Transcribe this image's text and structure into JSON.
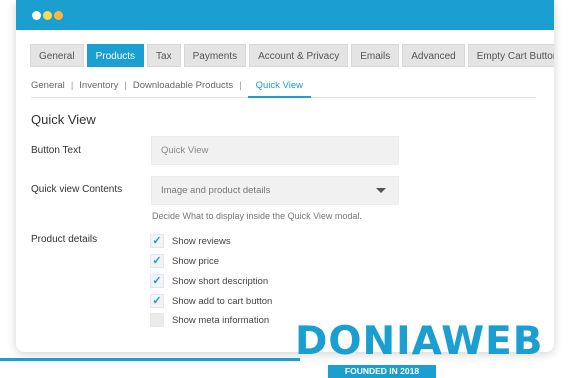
{
  "tabs": [
    {
      "label": "General",
      "active": false
    },
    {
      "label": "Products",
      "active": true
    },
    {
      "label": "Tax",
      "active": false
    },
    {
      "label": "Payments",
      "active": false
    },
    {
      "label": "Account & Privacy",
      "active": false
    },
    {
      "label": "Emails",
      "active": false
    },
    {
      "label": "Advanced",
      "active": false
    },
    {
      "label": "Empty Cart Button",
      "active": false
    }
  ],
  "subnav": {
    "items": [
      "General",
      "Inventory",
      "Downloadable Products",
      "Quick View"
    ],
    "separator": "|",
    "active": "Quick View"
  },
  "section": {
    "title": "Quick View"
  },
  "fields": {
    "button_text": {
      "label": "Button Text",
      "value": "Quick View"
    },
    "contents": {
      "label": "Quick view Contents",
      "selected": "Image and product details",
      "help": "Decide What to display inside the Quick View modal."
    },
    "product_details": {
      "label": "Product details",
      "options": [
        {
          "label": "Show reviews",
          "checked": true
        },
        {
          "label": "Show price",
          "checked": true
        },
        {
          "label": "Show short description",
          "checked": true
        },
        {
          "label": "Show add to cart button",
          "checked": true
        },
        {
          "label": "Show meta information",
          "checked": false
        }
      ]
    }
  },
  "brand": {
    "name": "DONIAWEB",
    "tagline": "FOUNDED IN 2018"
  },
  "colors": {
    "accent": "#1a9fd0",
    "titlebar": "#1a9fd0"
  }
}
